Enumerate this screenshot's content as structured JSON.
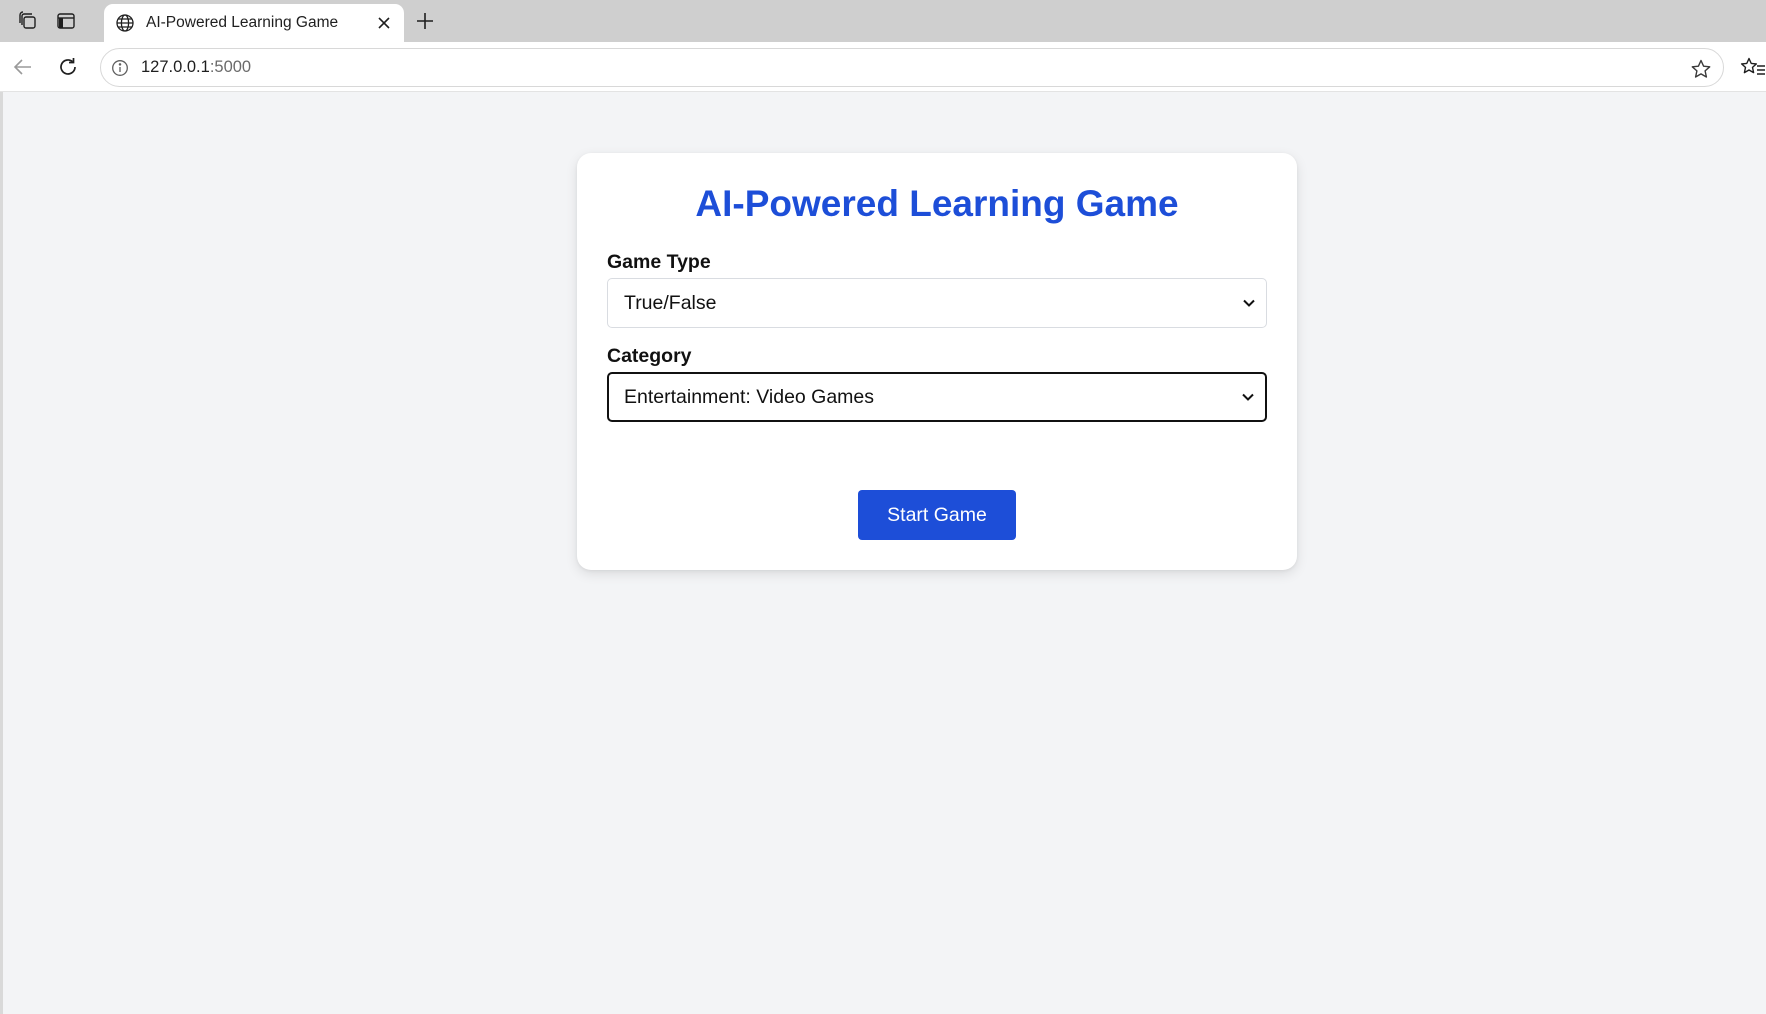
{
  "browser": {
    "tab": {
      "title": "AI-Powered Learning Game"
    },
    "address": {
      "host": "127.0.0.1",
      "port": ":5000"
    }
  },
  "page": {
    "title": "AI-Powered Learning Game",
    "game_type": {
      "label": "Game Type",
      "selected": "True/False"
    },
    "category": {
      "label": "Category",
      "selected": "Entertainment: Video Games"
    },
    "start_button": "Start Game"
  },
  "colors": {
    "accent": "#1d4ed8",
    "page_background": "#f3f4f6",
    "card_background": "#ffffff"
  },
  "icons": {
    "workspaces": "workspaces-icon",
    "vertical_tabs": "vertical-tabs-icon",
    "tab_favicon": "globe-icon",
    "tab_close": "close-icon",
    "new_tab": "plus-icon",
    "back": "back-arrow-icon",
    "reload": "reload-icon",
    "site_info": "info-icon",
    "favorite": "star-icon",
    "favorites_list": "favorites-icon",
    "dropdown": "chevron-down-icon"
  }
}
